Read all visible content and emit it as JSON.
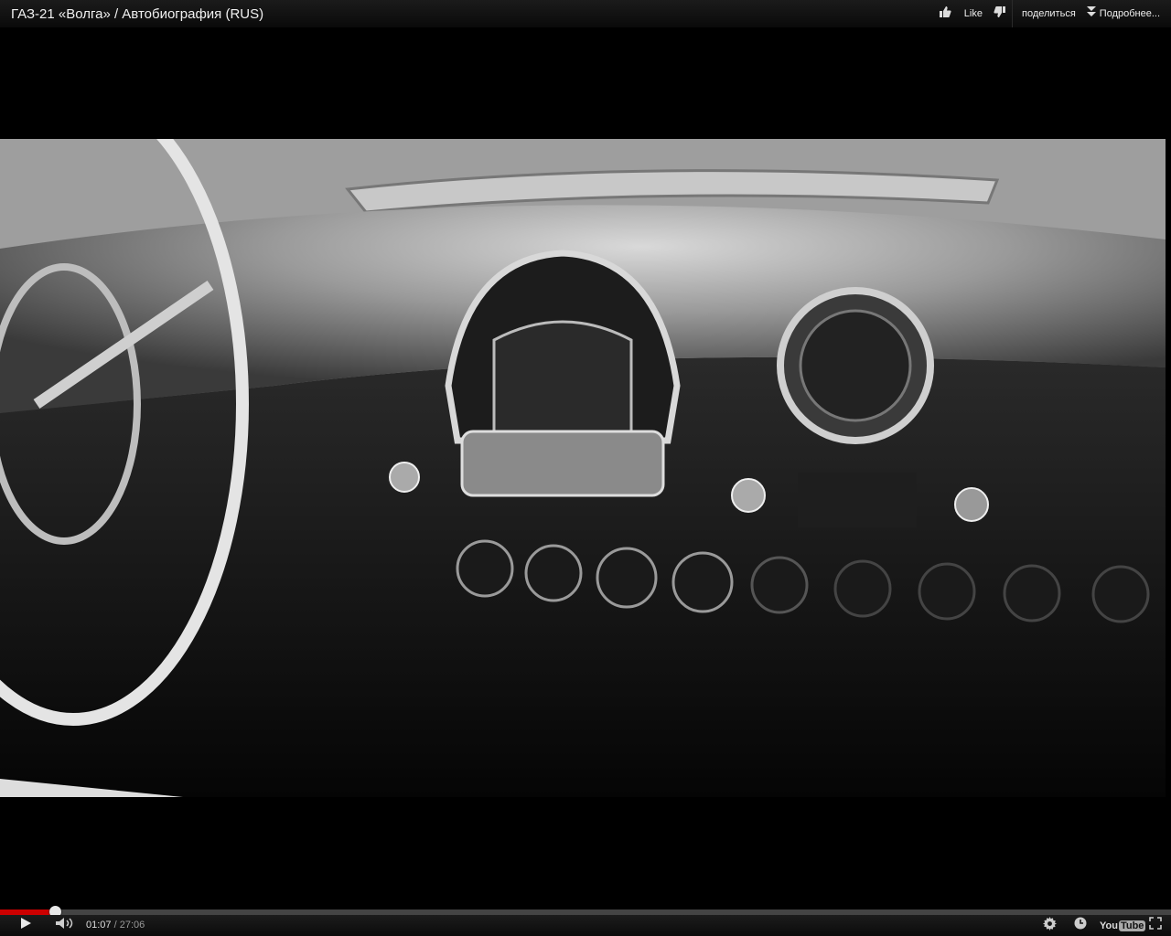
{
  "header": {
    "title": "ГАЗ-21 «Волга» / Автобиография (RUS)",
    "like_label": "Like",
    "share_label": "поделиться",
    "more_label": "Подробнее..."
  },
  "player": {
    "current_time": "01:07",
    "separator": " / ",
    "duration": "27:06",
    "played_fraction": 0.047,
    "loaded_fraction": 0.049,
    "logo_you": "You",
    "logo_tube": "Tube"
  },
  "icons": {
    "like": "thumbs-up-icon",
    "dislike": "thumbs-down-icon",
    "more": "double-chevron-down-icon",
    "play": "play-icon",
    "volume": "volume-icon",
    "settings": "gear-icon",
    "watch_later": "clock-icon",
    "fullscreen": "fullscreen-icon"
  }
}
